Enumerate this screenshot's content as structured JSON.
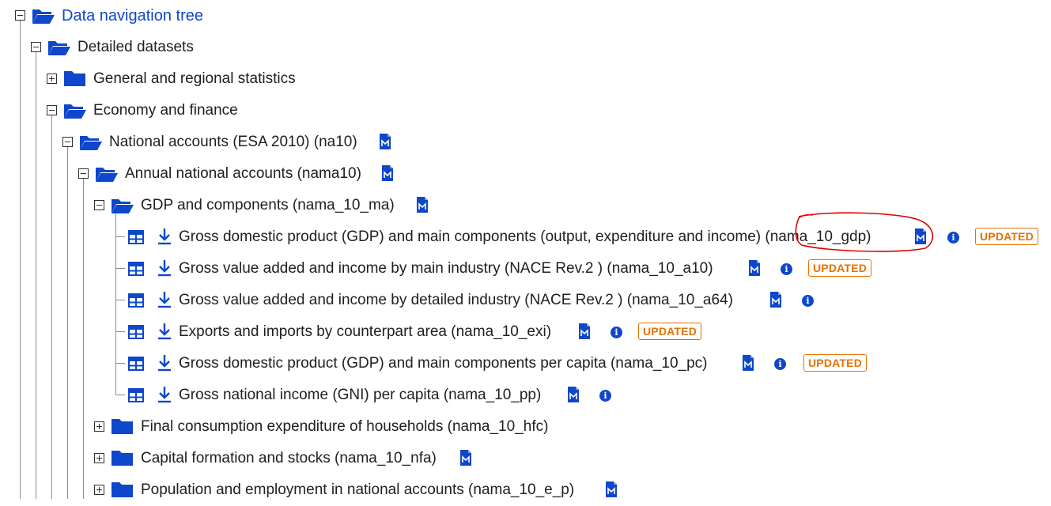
{
  "tree": {
    "root": {
      "label": "Data navigation tree",
      "state": "expanded"
    },
    "detailed": {
      "label": "Detailed datasets",
      "state": "expanded"
    },
    "general": {
      "label": "General and regional statistics",
      "state": "collapsed"
    },
    "economy": {
      "label": "Economy and finance",
      "state": "expanded"
    },
    "na10": {
      "label": "National accounts (ESA 2010) (na10)",
      "state": "expanded"
    },
    "nama10": {
      "label": "Annual national accounts (nama10)",
      "state": "expanded"
    },
    "gdp_components": {
      "label": "GDP and components (nama_10_ma)",
      "state": "expanded"
    },
    "datasets": [
      {
        "label": "Gross domestic product (GDP) and main components (output, expenditure and income) (nama_10_gdp)",
        "badge": "UPDATED"
      },
      {
        "label": "Gross value added and income by main industry (NACE Rev.2 ) (nama_10_a10)",
        "badge": "UPDATED"
      },
      {
        "label": "Gross value added and income by detailed industry (NACE Rev.2 ) (nama_10_a64)",
        "badge": ""
      },
      {
        "label": "Exports and imports by counterpart area (nama_10_exi)",
        "badge": "UPDATED"
      },
      {
        "label": "Gross domestic product (GDP) and main components per capita (nama_10_pc)",
        "badge": "UPDATED"
      },
      {
        "label": "Gross national income (GNI) per capita (nama_10_pp)",
        "badge": ""
      }
    ],
    "hfc": {
      "label": "Final consumption expenditure of households (nama_10_hfc)",
      "state": "collapsed"
    },
    "nfa": {
      "label": "Capital formation and stocks (nama_10_nfa)",
      "state": "collapsed"
    },
    "e_p": {
      "label": "Population and employment in national accounts (nama_10_e_p)",
      "state": "collapsed"
    }
  },
  "icons": {
    "folder_open": "folder-open-icon",
    "folder_closed": "folder-icon",
    "table": "table-icon",
    "download": "download-icon",
    "metadata": "metadata-icon",
    "info": "info-icon",
    "info_glyph": "i"
  },
  "colors": {
    "accent": "#0e47cb",
    "badge": "#e57100",
    "annotation": "#e00000"
  }
}
